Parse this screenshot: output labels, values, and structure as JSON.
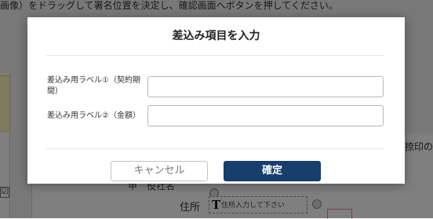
{
  "background": {
    "instruction_text": "画像）をドラッグして署名位置を決定し、確認画面へボタンを押してください。",
    "side_text": "捺印の",
    "cut_text": "甲　役社名",
    "address_label": "住所",
    "field_icon_glyph": "T",
    "field_placeholder": "住所入力して下さい",
    "checkbox_glyph": "☑"
  },
  "modal": {
    "title": "差込み項目を入力",
    "fields": [
      {
        "label": "差込み用ラベル①（契約期間）",
        "value": "",
        "placeholder": ""
      },
      {
        "label": "差込み用ラベル②（金額）",
        "value": "",
        "placeholder": ""
      }
    ],
    "cancel_label": "キャンセル",
    "confirm_label": "確定"
  },
  "colors": {
    "overlay": "rgba(0,0,0,0.5)",
    "confirm_button": "#163f6b",
    "modal_background": "#ffffff"
  }
}
